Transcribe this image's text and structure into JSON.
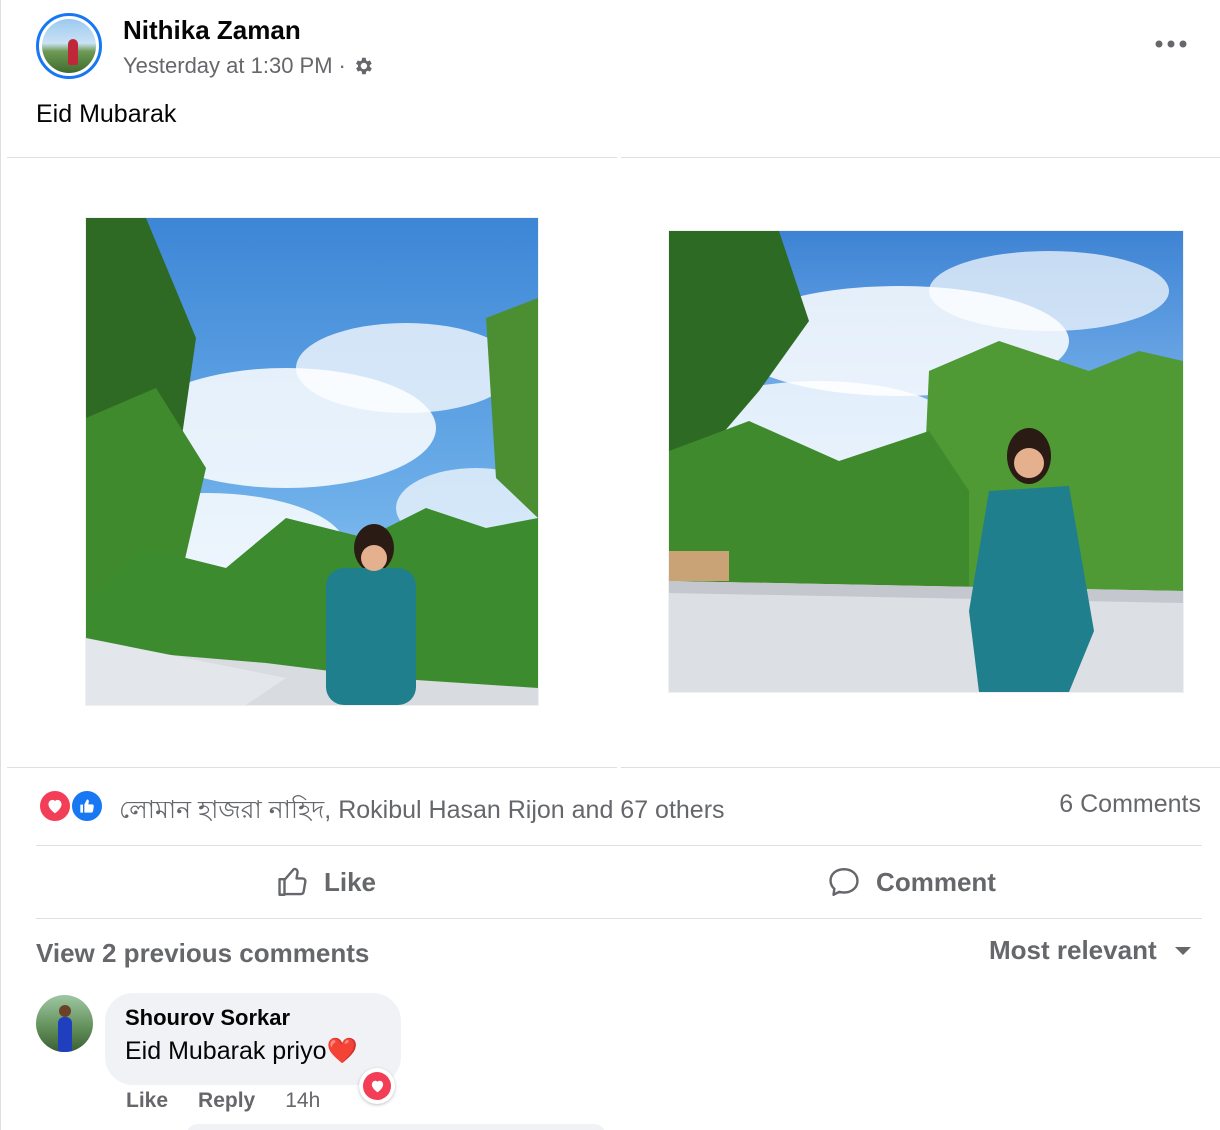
{
  "post": {
    "author": "Nithika Zaman",
    "timestamp": "Yesterday at 1:30 PM",
    "separator": "·",
    "privacy_icon": "gear-icon",
    "text": "Eid Mubarak"
  },
  "reactions": {
    "icons": [
      "love-reaction-icon",
      "like-reaction-icon"
    ],
    "summary": "লোমান হাজরা নাহিদ, Rokibul Hasan Rijon and 67 others",
    "comments_count": "6 Comments"
  },
  "actions": {
    "like_label": "Like",
    "comment_label": "Comment"
  },
  "comments_section": {
    "view_previous": "View 2 previous comments",
    "sort_label": "Most relevant"
  },
  "comment": {
    "author": "Shourov Sorkar",
    "text": "Eid Mubarak priyo",
    "emoji": "❤️",
    "like_label": "Like",
    "reply_label": "Reply",
    "time": "14h"
  },
  "colors": {
    "accent": "#1877f2",
    "love": "#f33e58",
    "secondary_text": "#65676b",
    "bubble": "#f0f2f5"
  }
}
